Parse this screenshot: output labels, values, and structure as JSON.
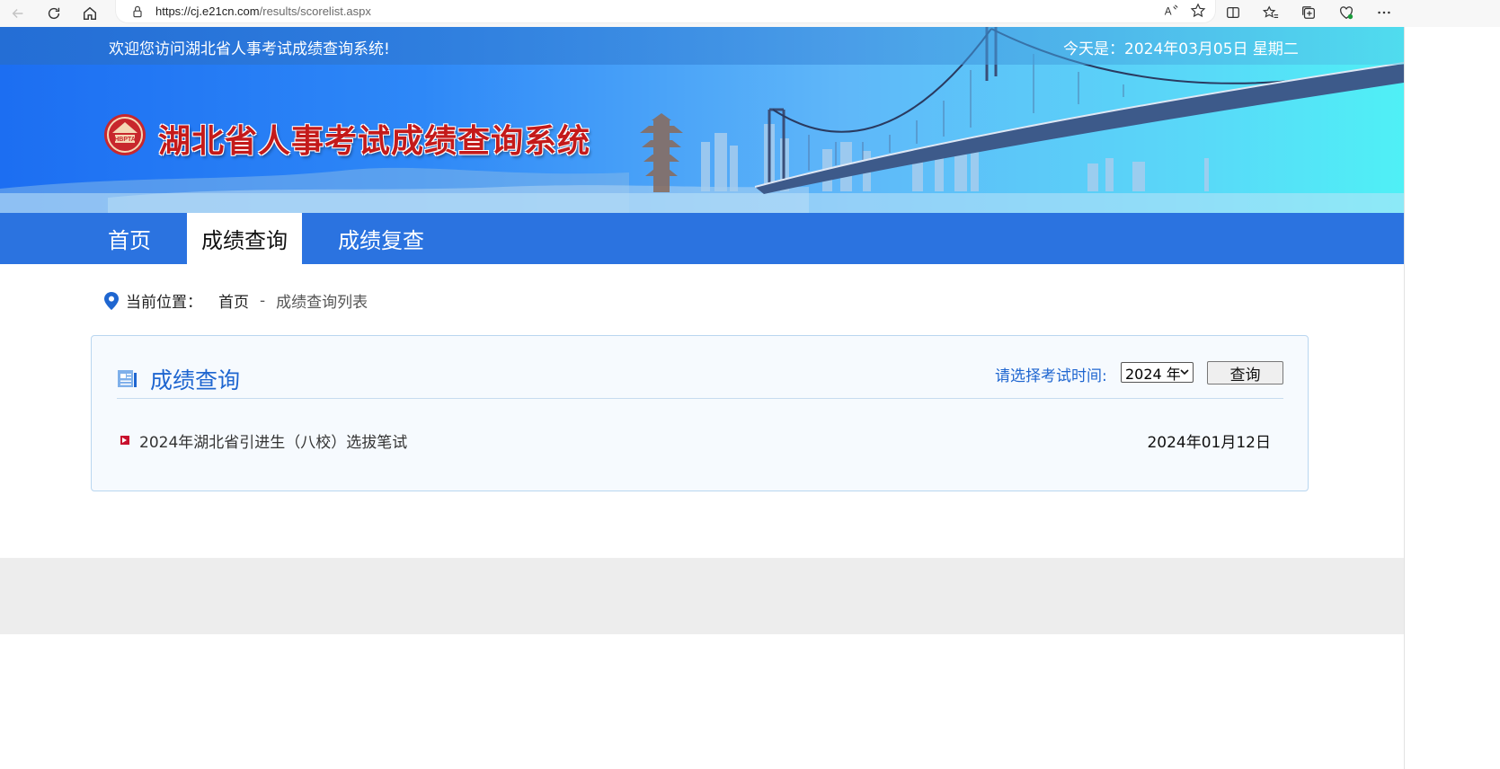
{
  "browser": {
    "url_host": "https://cj.e21cn.com",
    "url_path": "/results/scorelist.aspx"
  },
  "header": {
    "welcome": "欢迎您访问湖北省人事考试成绩查询系统!",
    "today": "今天是：2024年03月05日 星期二",
    "title": "湖北省人事考试成绩查询系统",
    "emblem_text": "HBPTA"
  },
  "nav": {
    "items": [
      {
        "label": "首页"
      },
      {
        "label": "成绩查询"
      },
      {
        "label": "成绩复查"
      }
    ]
  },
  "breadcrumb": {
    "label": "当前位置：",
    "home": "首页",
    "separator": "-",
    "current": "成绩查询列表"
  },
  "panel": {
    "title": "成绩查询",
    "filter_label": "请选择考试时间:",
    "year_selected": "2024 年",
    "query_button": "查询",
    "items": [
      {
        "title": "2024年湖北省引进生（八校）选拔笔试",
        "date": "2024年01月12日"
      }
    ]
  },
  "colors": {
    "nav_bg": "#2b73e0",
    "title_red": "#c41a1a",
    "accent_blue": "#1f66d0"
  }
}
